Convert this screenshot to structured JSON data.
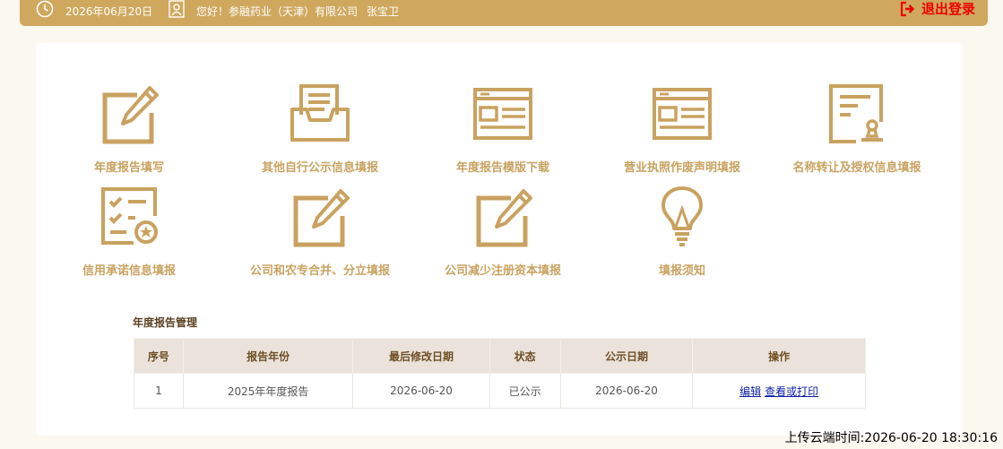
{
  "header": {
    "date": "2026年06月20日",
    "greeting": "您好！",
    "company": "参融药业（天津）有限公司",
    "user": "张宝卫",
    "logout_label": "退出登录"
  },
  "tiles": [
    {
      "label": "年度报告填写",
      "icon": "edit-icon"
    },
    {
      "label": "其他自行公示信息填报",
      "icon": "inbox-tray-icon"
    },
    {
      "label": "年度报告模版下载",
      "icon": "template-window-icon"
    },
    {
      "label": "营业执照作废声明填报",
      "icon": "license-window-icon"
    },
    {
      "label": "名称转让及授权信息填报",
      "icon": "certificate-stamp-icon"
    },
    {
      "label": "信用承诺信息填报",
      "icon": "checklist-badge-icon"
    },
    {
      "label": "公司和农专合并、分立填报",
      "icon": "edit-icon"
    },
    {
      "label": "公司减少注册资本填报",
      "icon": "edit-icon"
    },
    {
      "label": "填报须知",
      "icon": "lightbulb-icon"
    }
  ],
  "report_section": {
    "title": "年度报告管理",
    "columns": [
      "序号",
      "报告年份",
      "最后修改日期",
      "状态",
      "公示日期",
      "操作"
    ],
    "rows": [
      {
        "index": "1",
        "year": "2025年年度报告",
        "modified": "2026-06-20",
        "status": "已公示",
        "published": "2026-06-20",
        "action_edit": "编辑",
        "action_view": "查看或打印"
      }
    ]
  },
  "footer": {
    "sync_label": "上传云端时间:",
    "sync_time": "2026-06-20 18:30:16"
  },
  "colors": {
    "gold": "#cfa85e",
    "tile_text": "#c9a260",
    "logout": "#e00000"
  }
}
